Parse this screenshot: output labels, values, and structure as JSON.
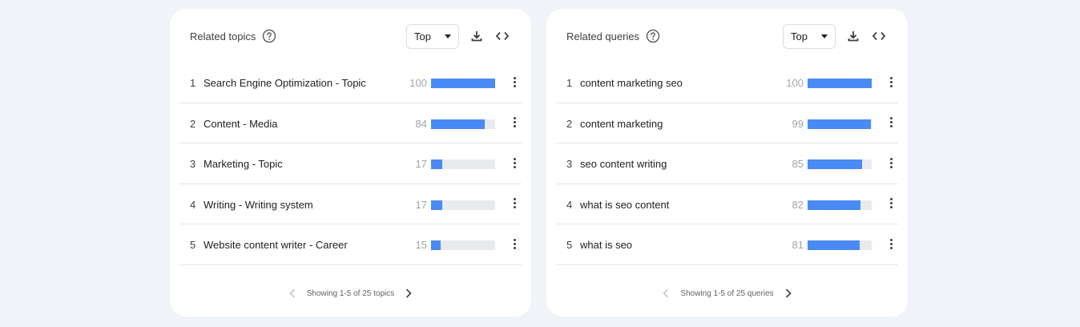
{
  "topics": {
    "title": "Related topics",
    "dropdown_value": "Top",
    "items": [
      {
        "rank": "1",
        "label": "Search Engine Optimization - Topic",
        "value": "100",
        "pct": 100
      },
      {
        "rank": "2",
        "label": "Content - Media",
        "value": "84",
        "pct": 84
      },
      {
        "rank": "3",
        "label": "Marketing - Topic",
        "value": "17",
        "pct": 17
      },
      {
        "rank": "4",
        "label": "Writing - Writing system",
        "value": "17",
        "pct": 17
      },
      {
        "rank": "5",
        "label": "Website content writer - Career",
        "value": "15",
        "pct": 15
      }
    ],
    "pager_text": "Showing 1-5 of 25 topics"
  },
  "queries": {
    "title": "Related queries",
    "dropdown_value": "Top",
    "items": [
      {
        "rank": "1",
        "label": "content marketing seo",
        "value": "100",
        "pct": 100
      },
      {
        "rank": "2",
        "label": "content marketing",
        "value": "99",
        "pct": 99
      },
      {
        "rank": "3",
        "label": "seo content writing",
        "value": "85",
        "pct": 85
      },
      {
        "rank": "4",
        "label": "what is seo content",
        "value": "82",
        "pct": 82
      },
      {
        "rank": "5",
        "label": "what is seo",
        "value": "81",
        "pct": 81
      }
    ],
    "pager_text": "Showing 1-5 of 25 queries"
  },
  "colors": {
    "bar": "#4a8af4",
    "track": "#e8eaed",
    "background": "#f0f3f8"
  },
  "icons": [
    "help-icon",
    "download-icon",
    "embed-code-icon",
    "more-vert-icon",
    "chevron-left-icon",
    "chevron-right-icon"
  ]
}
